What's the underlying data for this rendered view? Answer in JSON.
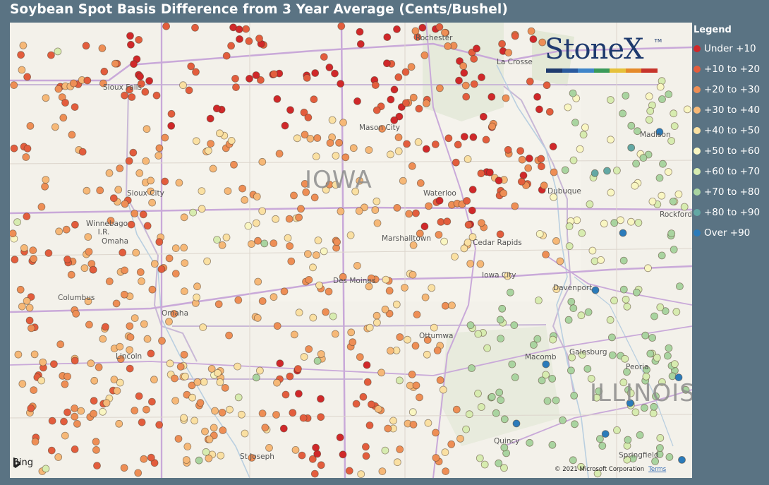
{
  "title": "Soybean Spot Basis Difference from 3 Year Average (Cents/Bushel)",
  "legend": {
    "title": "Legend",
    "items": [
      {
        "label": "Under +10",
        "color": "#d0282a"
      },
      {
        "label": "+10 to +20",
        "color": "#e35d3d"
      },
      {
        "label": "+20 to +30",
        "color": "#ee8e55"
      },
      {
        "label": "+30 to +40",
        "color": "#f6b877"
      },
      {
        "label": "+40 to +50",
        "color": "#fae0a2"
      },
      {
        "label": "+50 to +60",
        "color": "#f9f6c2"
      },
      {
        "label": "+60 to +70",
        "color": "#d7ecb0"
      },
      {
        "label": "+70 to +80",
        "color": "#a9d4a0"
      },
      {
        "label": "+80 to +90",
        "color": "#63a8a4"
      },
      {
        "label": "Over +90",
        "color": "#2b7bba"
      }
    ]
  },
  "map": {
    "states": [
      "IOWA",
      "ILLINOIS"
    ],
    "cities": [
      "Rochester",
      "La Crosse",
      "Sioux Falls",
      "Mason City",
      "Madison",
      "Dubuque",
      "Waterloo",
      "Sioux City",
      "Rockford",
      "Winnebago I.R.",
      "Omaha",
      "Marshalltown",
      "Cedar Rapids",
      "Iowa City",
      "Des Moines",
      "Davenport",
      "Columbus",
      "Omaha",
      "Ottumwa",
      "Galesburg",
      "Lincoln",
      "Macomb",
      "Peoria",
      "Quincy",
      "St Joseph",
      "Springfield"
    ],
    "attribution": "Bing",
    "copyright": "© 2021 Microsoft Corporation",
    "terms": "Terms"
  },
  "logo": {
    "text": "StoneX",
    "tm": "TM",
    "bar_colors": [
      "#1e3a6e",
      "#2a5a9e",
      "#3f85c9",
      "#3a9a5a",
      "#e6c13a",
      "#e58a2a",
      "#c7342b"
    ]
  }
}
